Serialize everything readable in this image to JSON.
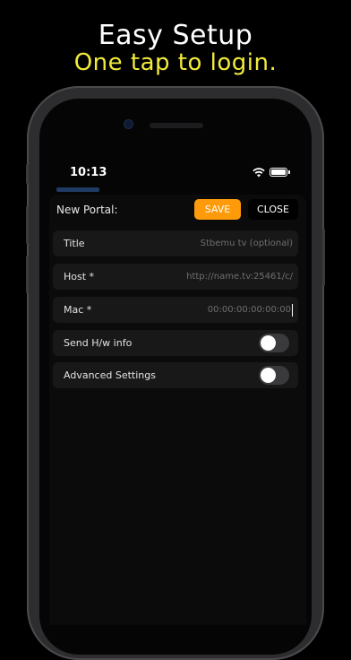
{
  "headline": {
    "title": "Easy Setup",
    "subtitle": "One tap to login."
  },
  "status_bar": {
    "time": "10:13"
  },
  "form": {
    "header_label": "New Portal:",
    "save_label": "SAVE",
    "close_label": "CLOSE",
    "fields": [
      {
        "label": "Title",
        "placeholder": "Stbemu tv (optional)"
      },
      {
        "label": "Host *",
        "placeholder": "http://name.tv:25461/c/"
      },
      {
        "label": "Mac *",
        "placeholder": "00:00:00:00:00:00"
      }
    ],
    "toggles": [
      {
        "label": "Send H/w info",
        "on": false
      },
      {
        "label": "Advanced Settings",
        "on": false
      }
    ]
  },
  "colors": {
    "accent": "#ff9a0a",
    "subtitle": "#f2eb3a",
    "background": "#000000"
  }
}
